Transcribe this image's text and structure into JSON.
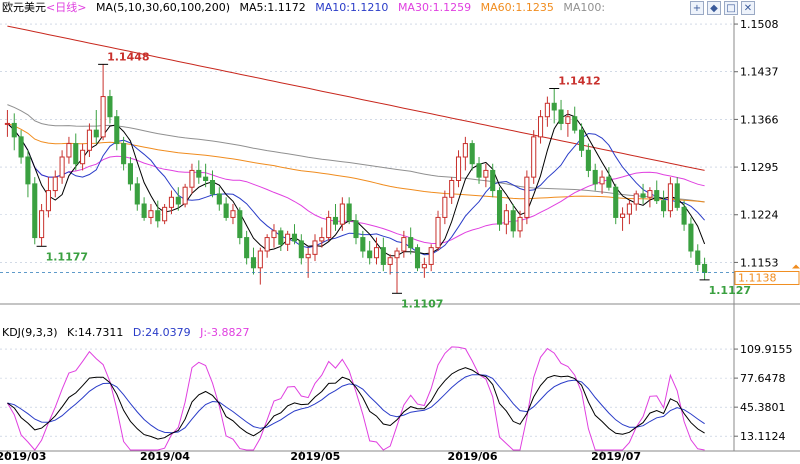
{
  "header": {
    "symbol": "欧元美元",
    "period": "<日线>",
    "ma_label": "MA(5,10,30,60,100,200)",
    "ma5": "MA5:1.1172",
    "ma10": "MA10:1.1210",
    "ma30": "MA30:1.1259",
    "ma60": "MA60:1.1235",
    "ma100": "MA100:"
  },
  "kdj_header": {
    "label": "KDJ(9,3,3)",
    "k": "K:14.7311",
    "d": "D:24.0379",
    "j": "J:-3.8827"
  },
  "toolbar": {
    "btn1": "+",
    "btn2": "◆",
    "btn3": "□",
    "btn4": "✕"
  },
  "colors": {
    "up": "#c8302c",
    "down": "#3aa040",
    "ma5": "#000000",
    "ma10": "#2a3cc8",
    "ma30": "#e040e0",
    "ma60": "#f08c1e",
    "ma100": "#909090",
    "ma200": "#c8281e",
    "k": "#000000",
    "d": "#2a3cc8",
    "j": "#e040e0",
    "grid": "#b8c4d8"
  },
  "chart_data": [
    {
      "type": "candlestick",
      "title": "欧元美元<日线>",
      "price_ticks": [
        "1.1508",
        "1.1437",
        "1.1366",
        "1.1295",
        "1.1224",
        "1.1153"
      ],
      "ylim": [
        1.11,
        1.152
      ],
      "x_labels": [
        "2019/03",
        "2019/04",
        "2019/05",
        "2019/06",
        "2019/07"
      ],
      "x_label_bar_index": [
        0,
        21,
        43,
        66,
        87
      ],
      "annotations": [
        {
          "text": "1.1448",
          "bar": 14,
          "price": 1.1448
        },
        {
          "text": "1.1177",
          "bar": 5,
          "price": 1.1177
        },
        {
          "text": "1.1107",
          "bar": 57,
          "price": 1.1107
        },
        {
          "text": "1.1412",
          "bar": 80,
          "price": 1.1412
        },
        {
          "text": "1.1127",
          "bar": 102,
          "price": 1.1127
        }
      ],
      "current_price": "1.1138",
      "current_value": 1.1138,
      "ohlc": [
        [
          1.136,
          1.138,
          1.134,
          1.136
        ],
        [
          1.136,
          1.1375,
          1.132,
          1.134
        ],
        [
          1.134,
          1.135,
          1.13,
          1.131
        ],
        [
          1.131,
          1.132,
          1.125,
          1.127
        ],
        [
          1.127,
          1.128,
          1.118,
          1.119
        ],
        [
          1.119,
          1.124,
          1.1177,
          1.123
        ],
        [
          1.123,
          1.128,
          1.122,
          1.126
        ],
        [
          1.126,
          1.129,
          1.125,
          1.128
        ],
        [
          1.128,
          1.132,
          1.127,
          1.131
        ],
        [
          1.131,
          1.134,
          1.13,
          1.133
        ],
        [
          1.133,
          1.1345,
          1.129,
          1.13
        ],
        [
          1.13,
          1.133,
          1.129,
          1.132
        ],
        [
          1.132,
          1.136,
          1.131,
          1.135
        ],
        [
          1.135,
          1.138,
          1.133,
          1.134
        ],
        [
          1.134,
          1.1448,
          1.1335,
          1.14
        ],
        [
          1.14,
          1.141,
          1.136,
          1.137
        ],
        [
          1.137,
          1.138,
          1.132,
          1.133
        ],
        [
          1.133,
          1.134,
          1.129,
          1.13
        ],
        [
          1.13,
          1.131,
          1.126,
          1.127
        ],
        [
          1.127,
          1.128,
          1.123,
          1.124
        ],
        [
          1.124,
          1.125,
          1.1215,
          1.122
        ],
        [
          1.122,
          1.124,
          1.121,
          1.123
        ],
        [
          1.123,
          1.1245,
          1.1205,
          1.1215
        ],
        [
          1.1215,
          1.124,
          1.121,
          1.1235
        ],
        [
          1.1235,
          1.126,
          1.1225,
          1.125
        ],
        [
          1.125,
          1.1265,
          1.123,
          1.124
        ],
        [
          1.124,
          1.127,
          1.1235,
          1.1265
        ],
        [
          1.1265,
          1.13,
          1.1255,
          1.129
        ],
        [
          1.129,
          1.1305,
          1.127,
          1.128
        ],
        [
          1.128,
          1.13,
          1.1265,
          1.1275
        ],
        [
          1.1275,
          1.129,
          1.125,
          1.1255
        ],
        [
          1.1255,
          1.1265,
          1.123,
          1.124
        ],
        [
          1.124,
          1.125,
          1.1215,
          1.122
        ],
        [
          1.122,
          1.124,
          1.121,
          1.123
        ],
        [
          1.123,
          1.1235,
          1.118,
          1.119
        ],
        [
          1.119,
          1.12,
          1.115,
          1.116
        ],
        [
          1.116,
          1.1175,
          1.1135,
          1.1145
        ],
        [
          1.1145,
          1.1175,
          1.112,
          1.117
        ],
        [
          1.117,
          1.1195,
          1.116,
          1.119
        ],
        [
          1.119,
          1.121,
          1.1175,
          1.12
        ],
        [
          1.12,
          1.1205,
          1.117,
          1.118
        ],
        [
          1.118,
          1.12,
          1.117,
          1.1195
        ],
        [
          1.1195,
          1.121,
          1.118,
          1.1185
        ],
        [
          1.1185,
          1.1195,
          1.115,
          1.116
        ],
        [
          1.116,
          1.1175,
          1.113,
          1.1165
        ],
        [
          1.1165,
          1.1195,
          1.1155,
          1.1185
        ],
        [
          1.1185,
          1.1205,
          1.1175,
          1.119
        ],
        [
          1.119,
          1.123,
          1.1185,
          1.122
        ],
        [
          1.122,
          1.124,
          1.12,
          1.121
        ],
        [
          1.121,
          1.125,
          1.12,
          1.124
        ],
        [
          1.124,
          1.125,
          1.121,
          1.1215
        ],
        [
          1.1215,
          1.1225,
          1.118,
          1.119
        ],
        [
          1.119,
          1.12,
          1.116,
          1.117
        ],
        [
          1.117,
          1.1185,
          1.115,
          1.116
        ],
        [
          1.116,
          1.119,
          1.115,
          1.1175
        ],
        [
          1.1175,
          1.119,
          1.114,
          1.115
        ],
        [
          1.115,
          1.1165,
          1.1135,
          1.116
        ],
        [
          1.116,
          1.1175,
          1.1107,
          1.117
        ],
        [
          1.117,
          1.12,
          1.116,
          1.119
        ],
        [
          1.119,
          1.1205,
          1.1165,
          1.1175
        ],
        [
          1.1175,
          1.118,
          1.114,
          1.1145
        ],
        [
          1.1145,
          1.116,
          1.113,
          1.115
        ],
        [
          1.115,
          1.118,
          1.114,
          1.1175
        ],
        [
          1.1175,
          1.123,
          1.117,
          1.122
        ],
        [
          1.122,
          1.126,
          1.121,
          1.125
        ],
        [
          1.125,
          1.128,
          1.124,
          1.1275
        ],
        [
          1.1275,
          1.132,
          1.1265,
          1.131
        ],
        [
          1.131,
          1.134,
          1.129,
          1.133
        ],
        [
          1.133,
          1.1335,
          1.129,
          1.13
        ],
        [
          1.13,
          1.131,
          1.127,
          1.128
        ],
        [
          1.128,
          1.13,
          1.1265,
          1.129
        ],
        [
          1.129,
          1.13,
          1.125,
          1.126
        ],
        [
          1.126,
          1.1265,
          1.12,
          1.121
        ],
        [
          1.121,
          1.124,
          1.1195,
          1.123
        ],
        [
          1.123,
          1.124,
          1.119,
          1.12
        ],
        [
          1.12,
          1.123,
          1.119,
          1.122
        ],
        [
          1.122,
          1.129,
          1.121,
          1.128
        ],
        [
          1.128,
          1.135,
          1.127,
          1.134
        ],
        [
          1.134,
          1.138,
          1.133,
          1.137
        ],
        [
          1.137,
          1.14,
          1.1355,
          1.139
        ],
        [
          1.139,
          1.1412,
          1.136,
          1.138
        ],
        [
          1.138,
          1.1395,
          1.135,
          1.136
        ],
        [
          1.136,
          1.138,
          1.134,
          1.137
        ],
        [
          1.137,
          1.1385,
          1.1345,
          1.135
        ],
        [
          1.135,
          1.136,
          1.131,
          1.132
        ],
        [
          1.132,
          1.133,
          1.128,
          1.129
        ],
        [
          1.129,
          1.13,
          1.126,
          1.127
        ],
        [
          1.127,
          1.129,
          1.1255,
          1.128
        ],
        [
          1.128,
          1.1295,
          1.126,
          1.1265
        ],
        [
          1.1265,
          1.127,
          1.121,
          1.122
        ],
        [
          1.122,
          1.1235,
          1.12,
          1.1225
        ],
        [
          1.1225,
          1.1245,
          1.121,
          1.124
        ],
        [
          1.124,
          1.126,
          1.123,
          1.1255
        ],
        [
          1.1255,
          1.127,
          1.124,
          1.125
        ],
        [
          1.125,
          1.1265,
          1.1235,
          1.126
        ],
        [
          1.126,
          1.1275,
          1.124,
          1.1245
        ],
        [
          1.1245,
          1.126,
          1.122,
          1.123
        ],
        [
          1.123,
          1.128,
          1.122,
          1.127
        ],
        [
          1.127,
          1.128,
          1.123,
          1.1235
        ],
        [
          1.1235,
          1.1245,
          1.12,
          1.121
        ],
        [
          1.121,
          1.122,
          1.116,
          1.117
        ],
        [
          1.117,
          1.118,
          1.114,
          1.115
        ],
        [
          1.115,
          1.116,
          1.1127,
          1.1138
        ]
      ],
      "ma_series": [
        {
          "name": "MA5"
        },
        {
          "name": "MA10"
        },
        {
          "name": "MA30"
        },
        {
          "name": "MA60"
        },
        {
          "name": "MA100"
        },
        {
          "name": "MA200"
        }
      ],
      "ma200_endpoints": [
        1.1505,
        1.129
      ],
      "ma100_endpoints": [
        1.14,
        1.1245
      ],
      "ma60_endpoints": [
        1.136,
        1.1232
      ]
    },
    {
      "type": "line",
      "title": "KDJ(9,3,3)",
      "y_ticks": [
        "109.9155",
        "77.6478",
        "45.3801",
        "13.1124"
      ],
      "ylim": [
        0,
        120
      ],
      "series": [
        {
          "name": "K"
        },
        {
          "name": "D"
        },
        {
          "name": "J"
        }
      ],
      "last_values": {
        "K": 14.7311,
        "D": 24.0379,
        "J": -3.8827
      }
    }
  ]
}
